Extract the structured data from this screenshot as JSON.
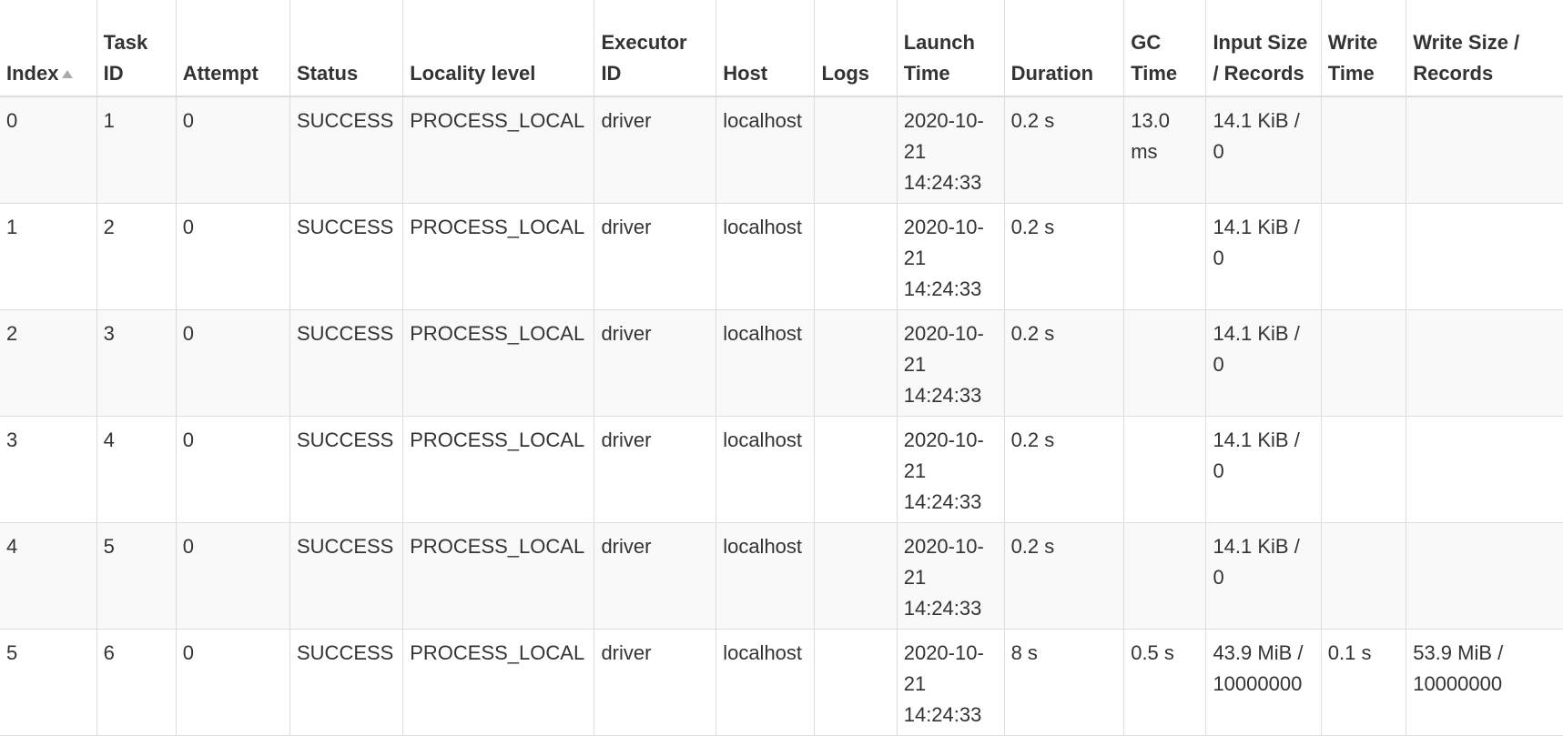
{
  "columns": [
    {
      "key": "index",
      "label": "Index",
      "sorted": "asc"
    },
    {
      "key": "task_id",
      "label": "Task ID"
    },
    {
      "key": "attempt",
      "label": "Attempt"
    },
    {
      "key": "status",
      "label": "Status"
    },
    {
      "key": "locality",
      "label": "Locality level"
    },
    {
      "key": "executor",
      "label": "Executor ID"
    },
    {
      "key": "host",
      "label": "Host"
    },
    {
      "key": "logs",
      "label": "Logs"
    },
    {
      "key": "launch",
      "label": "Launch Time"
    },
    {
      "key": "duration",
      "label": "Duration"
    },
    {
      "key": "gc",
      "label": "GC Time"
    },
    {
      "key": "input",
      "label": "Input Size / Records"
    },
    {
      "key": "write_time",
      "label": "Write Time"
    },
    {
      "key": "write_size",
      "label": "Write Size / Records"
    }
  ],
  "rows": [
    {
      "index": "0",
      "task_id": "1",
      "attempt": "0",
      "status": "SUCCESS",
      "locality": "PROCESS_LOCAL",
      "executor": "driver",
      "host": "localhost",
      "logs": "",
      "launch": "2020-10-21 14:24:33",
      "duration": "0.2 s",
      "gc": "13.0 ms",
      "input": "14.1 KiB / 0",
      "write_time": "",
      "write_size": ""
    },
    {
      "index": "1",
      "task_id": "2",
      "attempt": "0",
      "status": "SUCCESS",
      "locality": "PROCESS_LOCAL",
      "executor": "driver",
      "host": "localhost",
      "logs": "",
      "launch": "2020-10-21 14:24:33",
      "duration": "0.2 s",
      "gc": "",
      "input": "14.1 KiB / 0",
      "write_time": "",
      "write_size": ""
    },
    {
      "index": "2",
      "task_id": "3",
      "attempt": "0",
      "status": "SUCCESS",
      "locality": "PROCESS_LOCAL",
      "executor": "driver",
      "host": "localhost",
      "logs": "",
      "launch": "2020-10-21 14:24:33",
      "duration": "0.2 s",
      "gc": "",
      "input": "14.1 KiB / 0",
      "write_time": "",
      "write_size": ""
    },
    {
      "index": "3",
      "task_id": "4",
      "attempt": "0",
      "status": "SUCCESS",
      "locality": "PROCESS_LOCAL",
      "executor": "driver",
      "host": "localhost",
      "logs": "",
      "launch": "2020-10-21 14:24:33",
      "duration": "0.2 s",
      "gc": "",
      "input": "14.1 KiB / 0",
      "write_time": "",
      "write_size": ""
    },
    {
      "index": "4",
      "task_id": "5",
      "attempt": "0",
      "status": "SUCCESS",
      "locality": "PROCESS_LOCAL",
      "executor": "driver",
      "host": "localhost",
      "logs": "",
      "launch": "2020-10-21 14:24:33",
      "duration": "0.2 s",
      "gc": "",
      "input": "14.1 KiB / 0",
      "write_time": "",
      "write_size": ""
    },
    {
      "index": "5",
      "task_id": "6",
      "attempt": "0",
      "status": "SUCCESS",
      "locality": "PROCESS_LOCAL",
      "executor": "driver",
      "host": "localhost",
      "logs": "",
      "launch": "2020-10-21 14:24:33",
      "duration": "8 s",
      "gc": "0.5 s",
      "input": "43.9 MiB / 10000000",
      "write_time": "0.1 s",
      "write_size": "53.9 MiB / 10000000"
    }
  ]
}
